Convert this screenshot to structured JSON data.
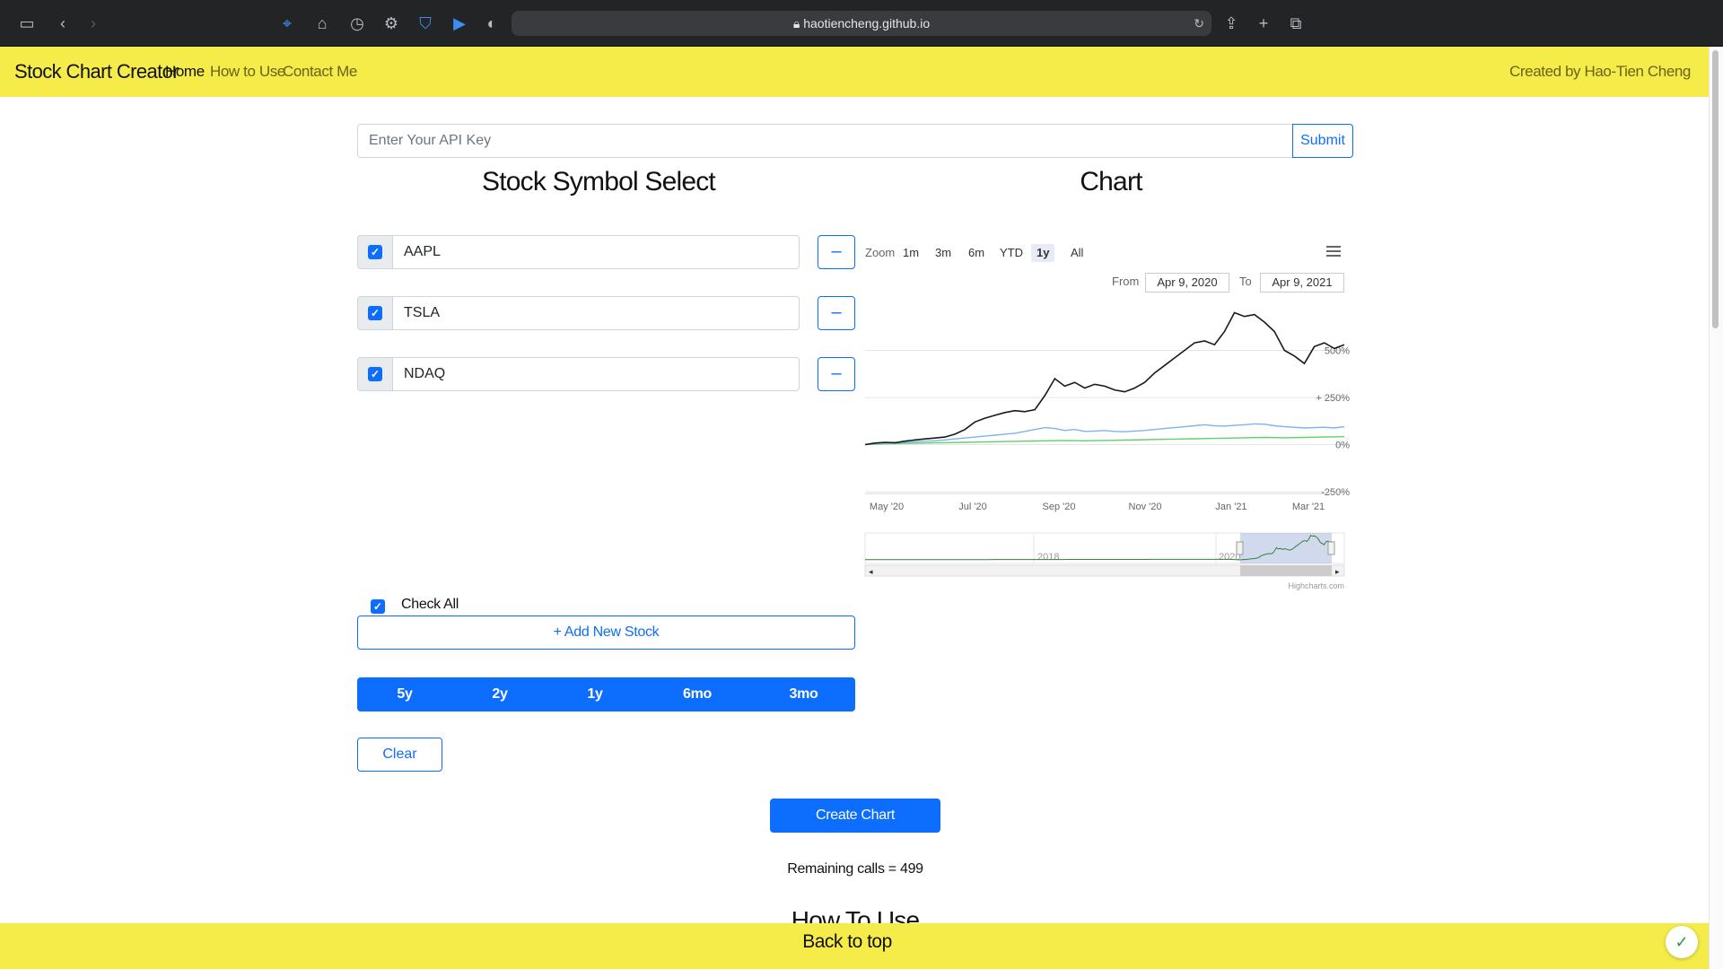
{
  "browser": {
    "url": "haotiencheng.github.io"
  },
  "nav": {
    "brand": "Stock Chart Creator",
    "links": [
      "Home",
      "How to Use",
      "Contact Me"
    ],
    "credit": "Created by Hao-Tien Cheng"
  },
  "api": {
    "placeholder": "Enter Your API Key",
    "submit_label": "Submit"
  },
  "stock_select": {
    "title": "Stock Symbol Select",
    "stocks": [
      {
        "symbol": "AAPL",
        "checked": true
      },
      {
        "symbol": "TSLA",
        "checked": true
      },
      {
        "symbol": "NDAQ",
        "checked": true
      }
    ],
    "remove_label": "–",
    "check_all_label": "Check All",
    "add_label": "+ Add New Stock",
    "periods": [
      "5y",
      "2y",
      "1y",
      "6mo",
      "3mo"
    ],
    "clear_label": "Clear"
  },
  "chart_panel": {
    "title": "Chart",
    "zoom_label": "Zoom",
    "zoom_buttons": [
      "1m",
      "3m",
      "6m",
      "YTD",
      "1y",
      "All"
    ],
    "zoom_active": "1y",
    "from_label": "From",
    "from_value": "Apr 9, 2020",
    "to_label": "To",
    "to_value": "Apr 9, 2021",
    "credits": "Highcharts.com",
    "navigator_labels": [
      "2018",
      "2020"
    ]
  },
  "chart_data": {
    "type": "line",
    "x_tick_labels": [
      "May '20",
      "Jul '20",
      "Sep '20",
      "Nov '20",
      "Jan '21",
      "Mar '21"
    ],
    "y_tick_labels": [
      "500%",
      "+ 250%",
      "0%",
      "-250%"
    ],
    "ylim": [
      -250,
      750
    ],
    "grid": true,
    "colors": {
      "series_1": "#1a1a1a",
      "series_2": "#7cb5ec",
      "series_3": "#5fd06a"
    },
    "series": [
      {
        "values": [
          0,
          8,
          12,
          10,
          18,
          25,
          30,
          35,
          40,
          55,
          80,
          120,
          140,
          155,
          170,
          180,
          175,
          185,
          260,
          350,
          310,
          330,
          300,
          320,
          310,
          290,
          280,
          300,
          330,
          380,
          420,
          460,
          500,
          540,
          550,
          530,
          600,
          700,
          680,
          690,
          650,
          600,
          500,
          470,
          430,
          520,
          540,
          510,
          530
        ]
      },
      {
        "values": [
          0,
          5,
          8,
          10,
          12,
          15,
          18,
          20,
          25,
          30,
          35,
          40,
          45,
          50,
          55,
          60,
          70,
          80,
          90,
          85,
          75,
          80,
          70,
          72,
          75,
          70,
          68,
          72,
          75,
          80,
          85,
          90,
          95,
          100,
          105,
          100,
          98,
          102,
          105,
          110,
          108,
          100,
          95,
          92,
          88,
          90,
          92,
          88,
          95
        ]
      },
      {
        "values": [
          0,
          2,
          4,
          5,
          6,
          7,
          8,
          9,
          10,
          11,
          12,
          13,
          14,
          15,
          16,
          17,
          18,
          19,
          20,
          21,
          22,
          21,
          20,
          21,
          22,
          23,
          24,
          25,
          26,
          27,
          28,
          29,
          30,
          31,
          32,
          33,
          34,
          35,
          36,
          37,
          38,
          37,
          36,
          37,
          38,
          39,
          40,
          41,
          42
        ]
      }
    ]
  },
  "footer": {
    "remaining_calls": "Remaining calls = 499",
    "how_to_use_heading": "How To Use",
    "back_to_top": "Back to top"
  }
}
